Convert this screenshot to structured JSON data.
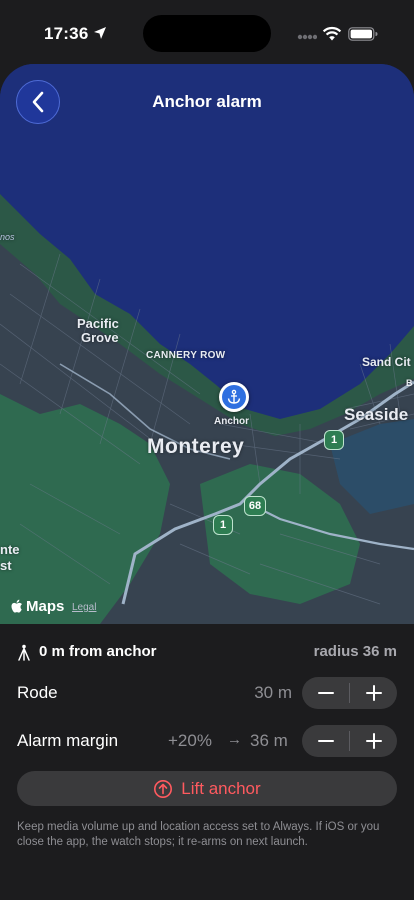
{
  "status": {
    "time": "17:36"
  },
  "nav": {
    "title": "Anchor alarm"
  },
  "map": {
    "labels": {
      "pacific_grove_1": "Pacific",
      "pacific_grove_2": "Grove",
      "cannery_row": "CANNERY ROW",
      "monterey": "Monterey",
      "seaside": "Seaside",
      "sand_city": "Sand Cit",
      "partial_left_top": "inos",
      "partial_left_1": "nte",
      "partial_left_2": "st",
      "partial_b": "B"
    },
    "anchor_label": "Anchor",
    "shields": {
      "hwy1_a": "1",
      "hwy1_b": "1",
      "hwy68": "68"
    },
    "brand": "Maps",
    "legal": "Legal"
  },
  "panel": {
    "distance": "0 m from anchor",
    "radius": "radius 36 m",
    "rode": {
      "label": "Rode",
      "value": "30 m"
    },
    "alarm_margin": {
      "label": "Alarm margin",
      "percent": "+20%",
      "arrow": "→",
      "value": "36 m"
    },
    "lift_label": "Lift anchor",
    "footnote": "Keep media volume up and location access set to Always. If iOS or you close the app, the watch stops; it re-arms on next launch."
  },
  "colors": {
    "accent": "#2f6fe0",
    "destructive": "#ff5a5f",
    "water": "#1d2f7a",
    "land": "#2c5847"
  }
}
